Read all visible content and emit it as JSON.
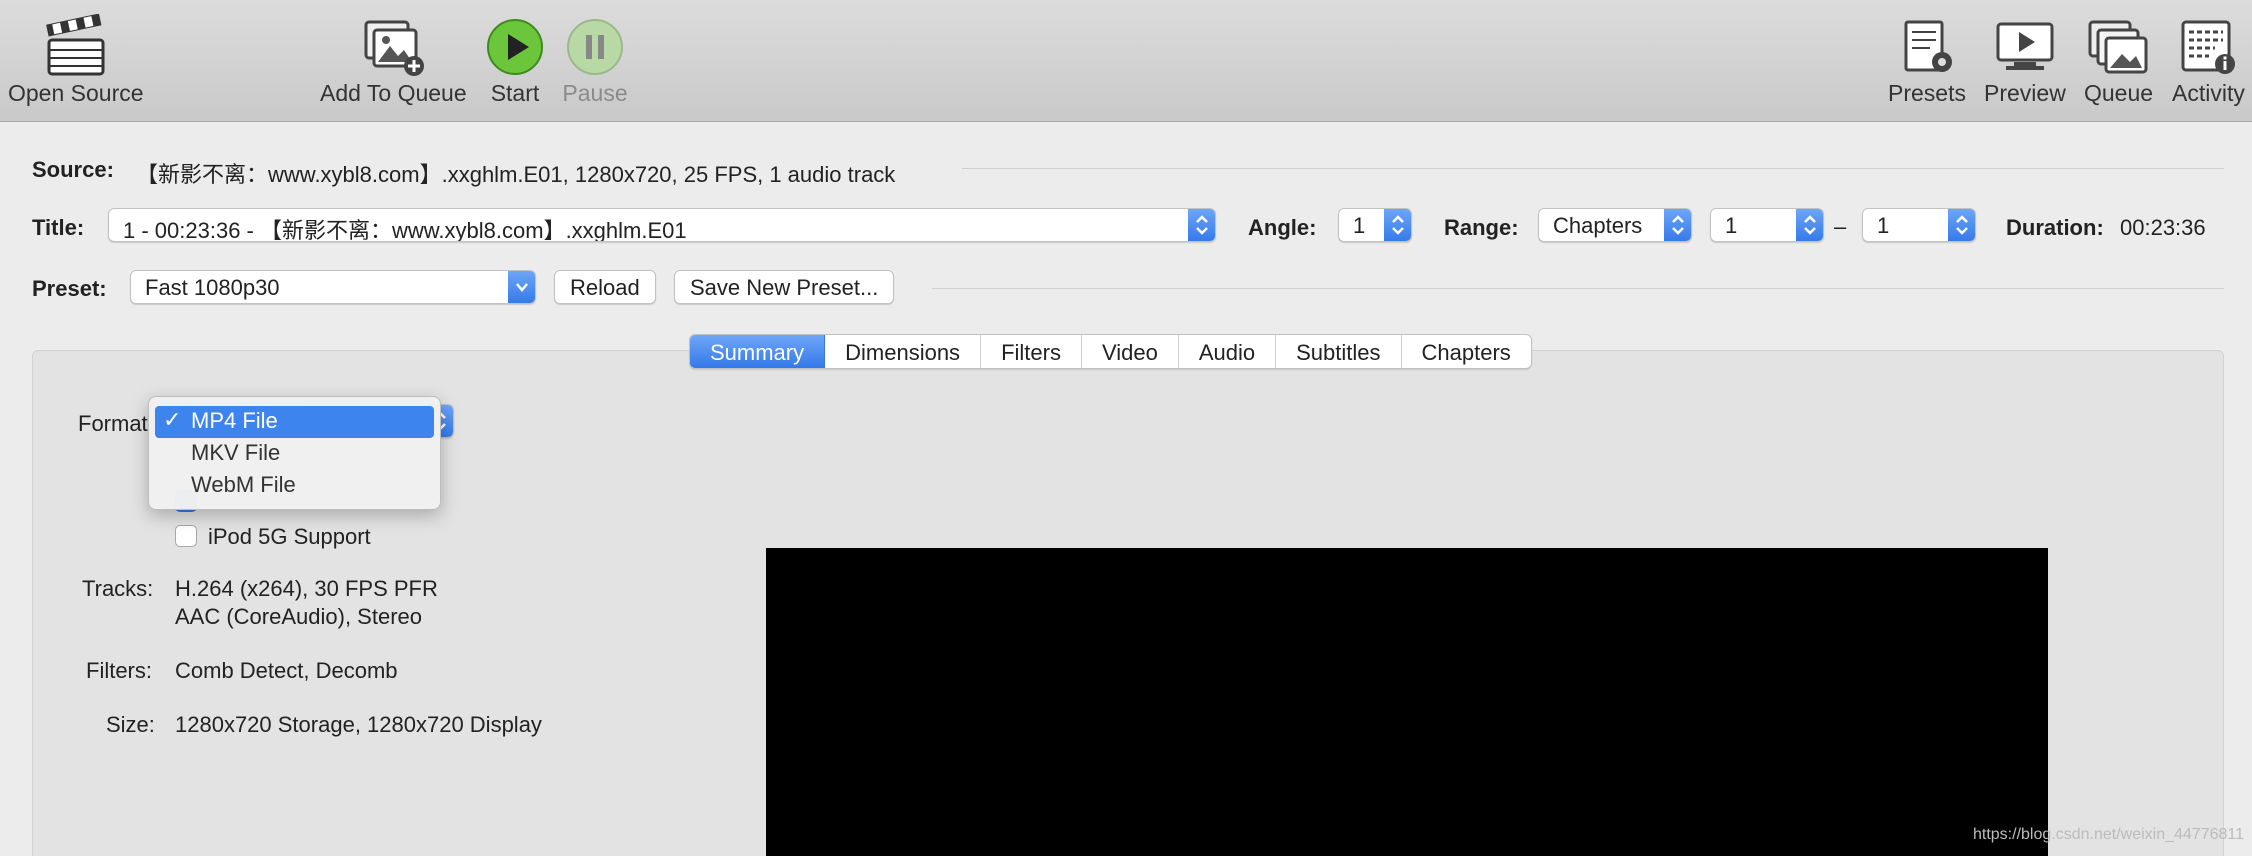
{
  "window_title": "【新影不离：www.xybl8.com】.xxghlm.E01",
  "toolbar": {
    "open_source": "Open Source",
    "add_to_queue": "Add To Queue",
    "start": "Start",
    "pause": "Pause",
    "presets": "Presets",
    "preview": "Preview",
    "queue": "Queue",
    "activity": "Activity"
  },
  "source": {
    "label": "Source:",
    "value": "【新影不离：www.xybl8.com】.xxghlm.E01, 1280x720, 25 FPS, 1 audio track"
  },
  "title_row": {
    "label": "Title:",
    "value": "1 - 00:23:36 - 【新影不离：www.xybl8.com】.xxghlm.E01",
    "angle_label": "Angle:",
    "angle_value": "1",
    "range_label": "Range:",
    "range_type": "Chapters",
    "range_start": "1",
    "range_dash": "–",
    "range_end": "1",
    "duration_label": "Duration:",
    "duration_value": "00:23:36"
  },
  "preset_row": {
    "label": "Preset:",
    "value": "Fast 1080p30",
    "reload": "Reload",
    "save_new": "Save New Preset..."
  },
  "tabs": [
    "Summary",
    "Dimensions",
    "Filters",
    "Video",
    "Audio",
    "Subtitles",
    "Chapters"
  ],
  "summary": {
    "format_label": "Format",
    "ipod_label": "iPod 5G Support",
    "tracks_label": "Tracks:",
    "tracks_line1": "H.264 (x264), 30 FPS PFR",
    "tracks_line2": "AAC (CoreAudio), Stereo",
    "filters_label": "Filters:",
    "filters_value": "Comb Detect, Decomb",
    "size_label": "Size:",
    "size_value": "1280x720 Storage, 1280x720 Display"
  },
  "format_menu": {
    "check": "✓",
    "items": [
      "MP4 File",
      "MKV File",
      "WebM File"
    ]
  },
  "watermark": "https://blog.csdn.net/weixin_44776811",
  "colors": {
    "accent": "#3479ea",
    "start_green": "#5ab82e"
  }
}
